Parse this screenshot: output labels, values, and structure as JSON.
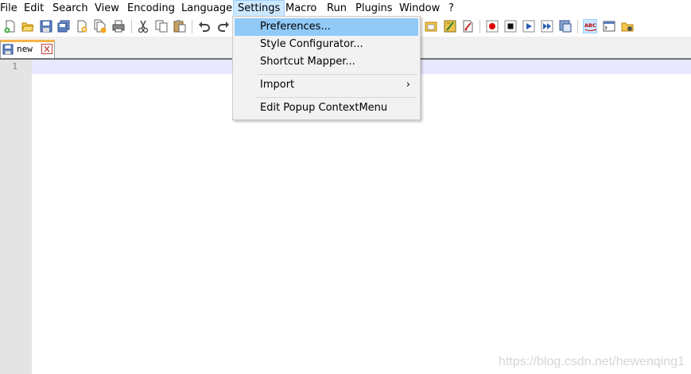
{
  "menubar": {
    "items": [
      {
        "label": "File",
        "active": false
      },
      {
        "label": "Edit",
        "active": false
      },
      {
        "label": "Search",
        "active": false
      },
      {
        "label": "View",
        "active": false
      },
      {
        "label": "Encoding",
        "active": false
      },
      {
        "label": "Language",
        "active": false
      },
      {
        "label": "Settings",
        "active": true
      },
      {
        "label": "Macro",
        "active": false
      },
      {
        "label": "Run",
        "active": false
      },
      {
        "label": "Plugins",
        "active": false
      },
      {
        "label": "Window",
        "active": false
      },
      {
        "label": "?",
        "active": false
      }
    ]
  },
  "toolbar": {
    "icons": [
      "new-file-icon",
      "open-file-icon",
      "save-icon",
      "save-all-icon",
      "close-icon",
      "close-all-icon",
      "print-icon",
      "cut-icon",
      "copy-icon",
      "paste-icon",
      "undo-icon",
      "redo-icon",
      "folder-as-workspace-icon",
      "function-list-icon",
      "document-map-icon",
      "record-macro-icon",
      "stop-recording-icon",
      "playback-macro-icon",
      "run-macro-multiple-icon",
      "save-macro-icon",
      "spell-check-icon",
      "console-icon",
      "folder-tree-icon"
    ],
    "spell_check_label": "ABC"
  },
  "tabs": [
    {
      "label": "new",
      "active": true
    }
  ],
  "editor": {
    "line_numbers": [
      "1"
    ]
  },
  "settings_menu": {
    "items": [
      {
        "label": "Preferences...",
        "highlighted": true,
        "submenu": false
      },
      {
        "label": "Style Configurator...",
        "highlighted": false,
        "submenu": false
      },
      {
        "label": "Shortcut Mapper...",
        "highlighted": false,
        "submenu": false
      },
      {
        "label": "Import",
        "highlighted": false,
        "submenu": true
      },
      {
        "label": "Edit Popup ContextMenu",
        "highlighted": false,
        "submenu": false
      }
    ],
    "submenu_arrow": "›"
  },
  "watermark": "https://blog.csdn.net/hewenqing1",
  "colors": {
    "menu_highlight": "#91c9f7",
    "active_menu": "#cce8ff",
    "current_line": "#e8e8ff",
    "tab_accent": "#fab34a",
    "record": "#e00000"
  }
}
